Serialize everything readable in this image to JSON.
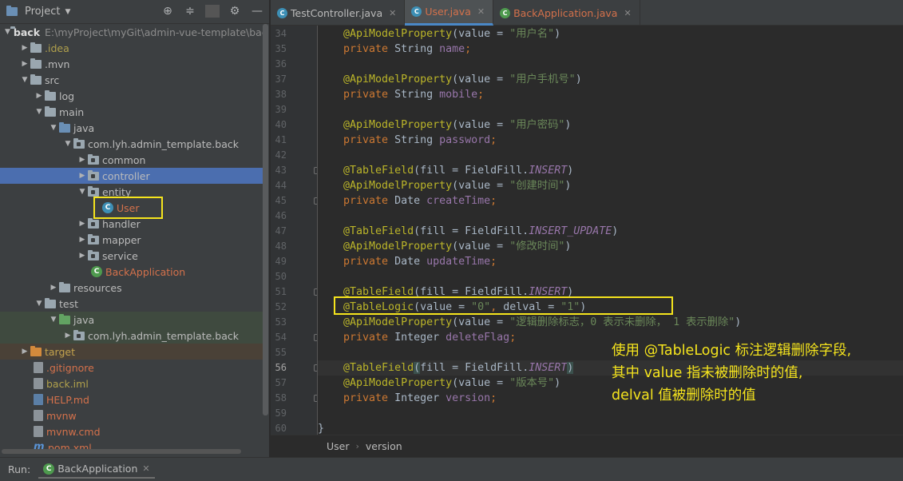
{
  "project": {
    "title": "Project",
    "tree": [
      {
        "label": "back",
        "path": "E:\\myProject\\myGit\\admin-vue-template\\back"
      },
      {
        "label": ".idea"
      },
      {
        "label": ".mvn"
      },
      {
        "label": "src"
      },
      {
        "label": "log"
      },
      {
        "label": "main"
      },
      {
        "label": "java"
      },
      {
        "label": "com.lyh.admin_template.back"
      },
      {
        "label": "common"
      },
      {
        "label": "controller"
      },
      {
        "label": "entity"
      },
      {
        "label": "User"
      },
      {
        "label": "handler"
      },
      {
        "label": "mapper"
      },
      {
        "label": "service"
      },
      {
        "label": "BackApplication"
      },
      {
        "label": "resources"
      },
      {
        "label": "test"
      },
      {
        "label": "java"
      },
      {
        "label": "com.lyh.admin_template.back"
      },
      {
        "label": "target"
      },
      {
        "label": ".gitignore"
      },
      {
        "label": "back.iml"
      },
      {
        "label": "HELP.md"
      },
      {
        "label": "mvnw"
      },
      {
        "label": "mvnw.cmd"
      },
      {
        "label": "pom.xml"
      }
    ]
  },
  "tabs": [
    {
      "label": "TestController.java"
    },
    {
      "label": "User.java"
    },
    {
      "label": "BackApplication.java"
    }
  ],
  "editor": {
    "current_line": 56,
    "lines": [
      {
        "n": "34",
        "parts": [
          [
            "ann",
            "    @ApiModelProperty"
          ],
          [
            "plain",
            "(value = "
          ],
          [
            "str",
            "\"用户名\""
          ],
          [
            "plain",
            ")"
          ]
        ]
      },
      {
        "n": "35",
        "parts": [
          [
            "kw",
            "    private "
          ],
          [
            "plain",
            "String "
          ],
          [
            "fld",
            "name"
          ],
          [
            "kw",
            ";"
          ]
        ]
      },
      {
        "n": "36",
        "parts": []
      },
      {
        "n": "37",
        "parts": [
          [
            "ann",
            "    @ApiModelProperty"
          ],
          [
            "plain",
            "(value = "
          ],
          [
            "str",
            "\"用户手机号\""
          ],
          [
            "plain",
            ")"
          ]
        ]
      },
      {
        "n": "38",
        "parts": [
          [
            "kw",
            "    private "
          ],
          [
            "plain",
            "String "
          ],
          [
            "fld",
            "mobile"
          ],
          [
            "kw",
            ";"
          ]
        ]
      },
      {
        "n": "39",
        "parts": []
      },
      {
        "n": "40",
        "parts": [
          [
            "ann",
            "    @ApiModelProperty"
          ],
          [
            "plain",
            "(value = "
          ],
          [
            "str",
            "\"用户密码\""
          ],
          [
            "plain",
            ")"
          ]
        ]
      },
      {
        "n": "41",
        "parts": [
          [
            "kw",
            "    private "
          ],
          [
            "plain",
            "String "
          ],
          [
            "fld",
            "password"
          ],
          [
            "kw",
            ";"
          ]
        ]
      },
      {
        "n": "42",
        "parts": []
      },
      {
        "n": "43",
        "parts": [
          [
            "ann",
            "    @TableField"
          ],
          [
            "plain",
            "(fill = FieldFill."
          ],
          [
            "it",
            "INSERT"
          ],
          [
            "plain",
            ")"
          ]
        ]
      },
      {
        "n": "44",
        "parts": [
          [
            "ann",
            "    @ApiModelProperty"
          ],
          [
            "plain",
            "(value = "
          ],
          [
            "str",
            "\"创建时间\""
          ],
          [
            "plain",
            ")"
          ]
        ]
      },
      {
        "n": "45",
        "parts": [
          [
            "kw",
            "    private "
          ],
          [
            "plain",
            "Date "
          ],
          [
            "fld",
            "createTime"
          ],
          [
            "kw",
            ";"
          ]
        ]
      },
      {
        "n": "46",
        "parts": []
      },
      {
        "n": "47",
        "parts": [
          [
            "ann",
            "    @TableField"
          ],
          [
            "plain",
            "(fill = FieldFill."
          ],
          [
            "it",
            "INSERT_UPDATE"
          ],
          [
            "plain",
            ")"
          ]
        ]
      },
      {
        "n": "48",
        "parts": [
          [
            "ann",
            "    @ApiModelProperty"
          ],
          [
            "plain",
            "(value = "
          ],
          [
            "str",
            "\"修改时间\""
          ],
          [
            "plain",
            ")"
          ]
        ]
      },
      {
        "n": "49",
        "parts": [
          [
            "kw",
            "    private "
          ],
          [
            "plain",
            "Date "
          ],
          [
            "fld",
            "updateTime"
          ],
          [
            "kw",
            ";"
          ]
        ]
      },
      {
        "n": "50",
        "parts": []
      },
      {
        "n": "51",
        "parts": [
          [
            "ann",
            "    @TableField"
          ],
          [
            "plain",
            "(fill = FieldFill."
          ],
          [
            "it",
            "INSERT"
          ],
          [
            "plain",
            ")"
          ]
        ]
      },
      {
        "n": "52",
        "parts": [
          [
            "ann",
            "    @TableLogic"
          ],
          [
            "plain",
            "(value = "
          ],
          [
            "str",
            "\"0\""
          ],
          [
            "kw",
            ", "
          ],
          [
            "plain",
            "delval = "
          ],
          [
            "str",
            "\"1\""
          ],
          [
            "plain",
            ")"
          ]
        ]
      },
      {
        "n": "53",
        "parts": [
          [
            "ann",
            "    @ApiModelProperty"
          ],
          [
            "plain",
            "(value = "
          ],
          [
            "str",
            "\"逻辑删除标志，0 表示未删除， 1 表示删除\""
          ],
          [
            "plain",
            ")"
          ]
        ]
      },
      {
        "n": "54",
        "parts": [
          [
            "kw",
            "    private "
          ],
          [
            "plain",
            "Integer "
          ],
          [
            "fld",
            "deleteFlag"
          ],
          [
            "kw",
            ";"
          ]
        ]
      },
      {
        "n": "55",
        "parts": []
      },
      {
        "n": "56",
        "parts": [
          [
            "ann",
            "    @TableField"
          ],
          [
            "hlp",
            "("
          ],
          [
            "plain",
            "fill = FieldFill."
          ],
          [
            "it",
            "INSERT"
          ],
          [
            "hlp",
            ")"
          ]
        ]
      },
      {
        "n": "57",
        "parts": [
          [
            "ann",
            "    @ApiModelProperty"
          ],
          [
            "plain",
            "(value = "
          ],
          [
            "str",
            "\"版本号\""
          ],
          [
            "plain",
            ")"
          ]
        ]
      },
      {
        "n": "58",
        "parts": [
          [
            "kw",
            "    private "
          ],
          [
            "plain",
            "Integer "
          ],
          [
            "fld",
            "version"
          ],
          [
            "kw",
            ";"
          ]
        ]
      },
      {
        "n": "59",
        "parts": []
      },
      {
        "n": "60",
        "parts": [
          [
            "plain",
            "}"
          ]
        ]
      }
    ]
  },
  "annotation": {
    "line1": "使用 @TableLogic 标注逻辑删除字段,",
    "line2": "其中 value 指未被删除时的值,",
    "line3": "delval 值被删除时的值"
  },
  "breadcrumb": {
    "items": [
      "User",
      "version"
    ]
  },
  "run": {
    "label": "Run:",
    "tab": "BackApplication"
  }
}
